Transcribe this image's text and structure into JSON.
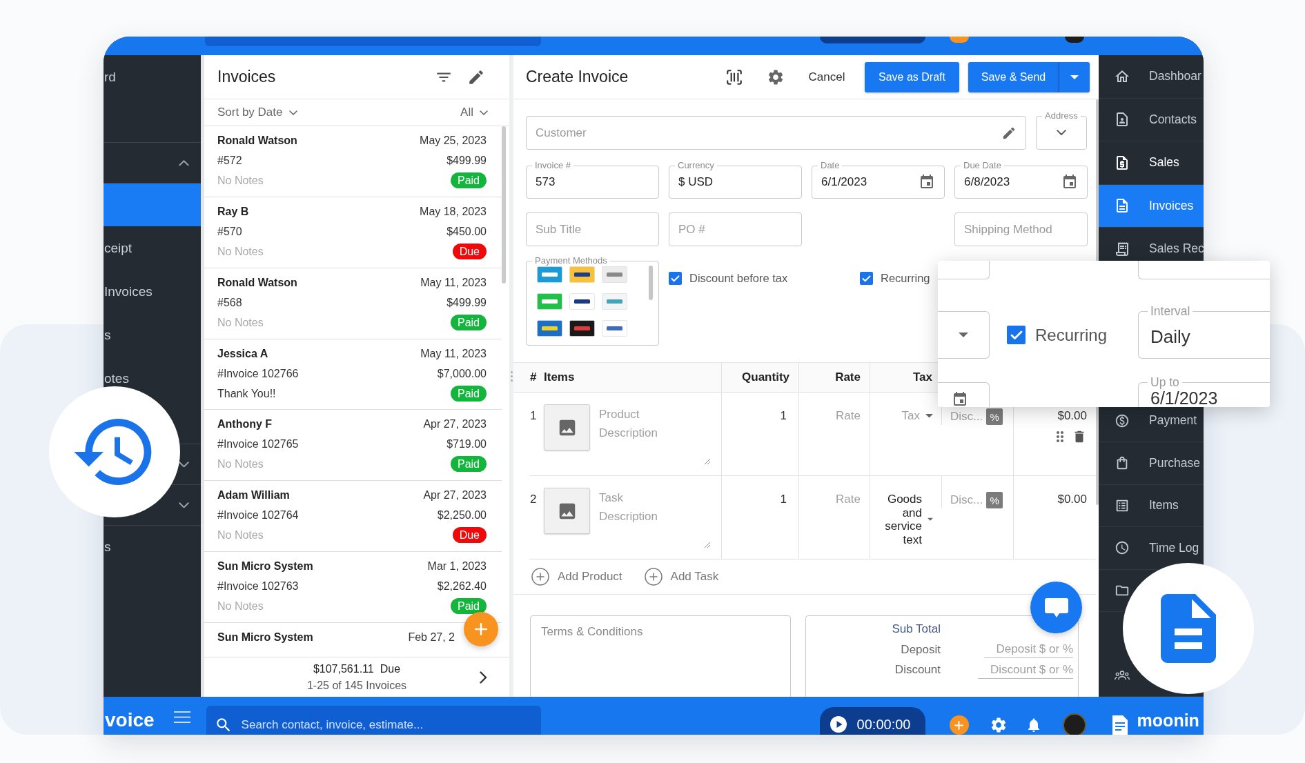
{
  "left_nav": {
    "items": [
      {
        "kind": "item",
        "label": "rd",
        "selected": false
      },
      {
        "kind": "group",
        "expanded": true
      },
      {
        "kind": "item",
        "selected": true
      },
      {
        "kind": "item",
        "label": "ceipt",
        "selected": false
      },
      {
        "kind": "item",
        "label": "Invoices",
        "selected": false
      },
      {
        "kind": "item",
        "label": "s",
        "selected": false
      },
      {
        "kind": "item",
        "label": "otes",
        "selected": false
      },
      {
        "kind": "group",
        "expanded": false
      },
      {
        "kind": "group",
        "expanded": false
      },
      {
        "kind": "item",
        "label": "s",
        "selected": false
      }
    ]
  },
  "invoice_list": {
    "title": "Invoices",
    "sort_label": "Sort by Date",
    "filter_label": "All",
    "rows": [
      {
        "name": "Ronald Watson",
        "number": "#572",
        "notes": "No Notes",
        "notes_empty": true,
        "date": "May 25, 2023",
        "amount": "$499.99",
        "badge": {
          "label": "Paid",
          "color": "#13b53c"
        }
      },
      {
        "name": "Ray B",
        "number": "#570",
        "notes": "No Notes",
        "notes_empty": true,
        "date": "May 18, 2023",
        "amount": "$450.00",
        "badge": {
          "label": "Due",
          "color": "#ee0a0a"
        }
      },
      {
        "name": "Ronald Watson",
        "number": "#568",
        "notes": "No Notes",
        "notes_empty": true,
        "date": "May 11, 2023",
        "amount": "$499.99",
        "badge": {
          "label": "Paid",
          "color": "#13b53c"
        }
      },
      {
        "name": "Jessica A",
        "number": "#Invoice 102766",
        "notes": "Thank You!!",
        "notes_empty": false,
        "date": "May 11, 2023",
        "amount": "$7,000.00",
        "badge": {
          "label": "Paid",
          "color": "#13b53c"
        }
      },
      {
        "name": "Anthony F",
        "number": "#Invoice 102765",
        "notes": "No Notes",
        "notes_empty": true,
        "date": "Apr 27, 2023",
        "amount": "$719.00",
        "badge": {
          "label": "Paid",
          "color": "#13b53c"
        }
      },
      {
        "name": "Adam William",
        "number": "#Invoice 102764",
        "notes": "No Notes",
        "notes_empty": true,
        "date": "Apr 27, 2023",
        "amount": "$2,250.00",
        "badge": {
          "label": "Due",
          "color": "#ee0a0a"
        }
      },
      {
        "name": "Sun Micro System",
        "number": "#Invoice 102763",
        "notes": "No Notes",
        "notes_empty": true,
        "date": "Mar 1, 2023",
        "amount": "$2,262.40",
        "badge": {
          "label": "Paid",
          "color": "#13b53c"
        }
      },
      {
        "name": "Sun Micro System",
        "date": "Feb 27, 2"
      }
    ],
    "footer": {
      "total": "$107,561.11",
      "total_label": "Due",
      "count": "1-25 of 145 Invoices"
    }
  },
  "editor": {
    "title": "Create Invoice",
    "cancel": "Cancel",
    "save_draft": "Save as Draft",
    "save_send": "Save & Send",
    "customer": {
      "placeholder": "Customer"
    },
    "address": {
      "label": "Address"
    },
    "fields": [
      {
        "label": "Invoice #",
        "value": "573",
        "kind": "text"
      },
      {
        "label": "Currency",
        "value": "$ USD",
        "kind": "text"
      },
      {
        "label": "Date",
        "value": "6/1/2023",
        "kind": "date"
      },
      {
        "label": "Due Date",
        "value": "6/8/2023",
        "kind": "date"
      }
    ],
    "more_fields": [
      {
        "placeholder": "Sub Title"
      },
      {
        "placeholder": "PO #"
      },
      {
        "placeholder": "Shipping Method"
      }
    ],
    "payment_methods": {
      "label": "Payment Methods"
    },
    "options": [
      {
        "label": "Discount before tax",
        "checked": true
      },
      {
        "label": "Recurring",
        "checked": true
      }
    ],
    "items_table": {
      "columns": [
        {
          "label": "#"
        },
        {
          "label": "Items"
        },
        {
          "label": "Quantity"
        },
        {
          "label": "Rate"
        },
        {
          "label": "Tax"
        }
      ],
      "rows": [
        {
          "number": "1",
          "placeholder": "Product Description",
          "quantity": "1",
          "rate_placeholder": "Rate",
          "tax_placeholder": "Tax",
          "discount_placeholder": "Disc...",
          "discount_unit": "%",
          "amount": "$0.00",
          "hovered": true
        },
        {
          "number": "2",
          "placeholder": "Task Description",
          "quantity": "1",
          "rate_placeholder": "Rate",
          "tax": "Goods and service text",
          "discount_placeholder": "Disc...",
          "discount_unit": "%",
          "amount": "$0.00",
          "hovered": false
        }
      ]
    },
    "add_buttons": [
      {
        "label": "Add Product"
      },
      {
        "label": "Add Task"
      }
    ],
    "terms": {
      "placeholder": "Terms & Conditions"
    },
    "totals": [
      {
        "label": "Sub Total",
        "kind": "total"
      },
      {
        "label": "Deposit",
        "kind": "input",
        "placeholder": "Deposit $ or %"
      },
      {
        "label": "Discount",
        "kind": "input",
        "placeholder": "Discount $ or %"
      }
    ]
  },
  "recurring_zoom": {
    "checkbox": {
      "label": "Recurring",
      "checked": true
    },
    "interval": {
      "label": "Interval",
      "value": "Daily"
    },
    "up_to": {
      "label": "Up to",
      "value": "6/1/2023"
    }
  },
  "right_nav": {
    "top_items": [
      {
        "label": "Dashboar",
        "selected": false,
        "expanded": false
      },
      {
        "label": "Contacts",
        "selected": false,
        "expanded": false
      },
      {
        "label": "Sales",
        "selected": false,
        "expanded": true
      },
      {
        "label": "Invoices",
        "selected": true,
        "expanded": false
      },
      {
        "label": "Sales Rec",
        "selected": false,
        "expanded": false
      }
    ],
    "bottom_items": [
      {
        "label": "Payment",
        "selected": false,
        "expanded": false
      },
      {
        "label": "Purchase",
        "selected": false,
        "expanded": false
      },
      {
        "label": "Items",
        "selected": false,
        "expanded": false
      },
      {
        "label": "Time Log",
        "selected": false,
        "expanded": false
      },
      {
        "selected": false,
        "expanded": false
      },
      {
        "selected": false,
        "expanded": false
      }
    ]
  },
  "bottom_bar": {
    "logo": "voice",
    "search": {
      "placeholder": "Search contact, invoice, estimate..."
    },
    "timer": "00:00:00",
    "brand": "moonin"
  }
}
